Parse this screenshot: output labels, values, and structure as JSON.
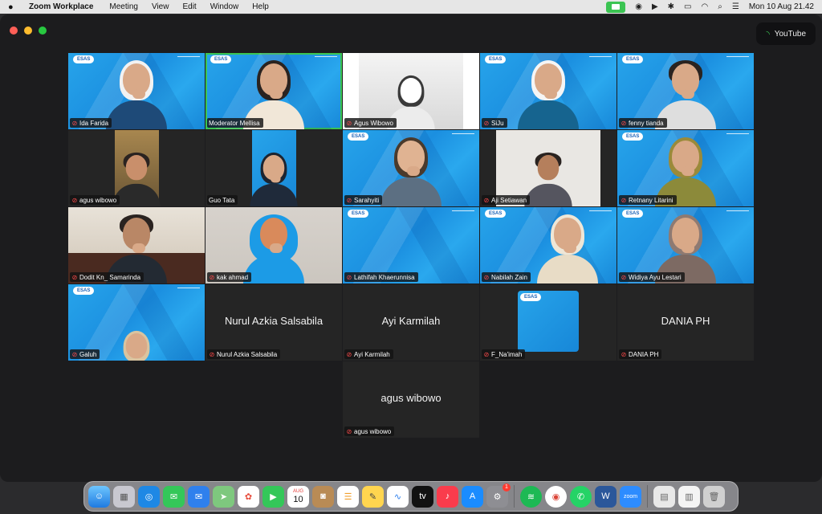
{
  "menubar": {
    "app_name": "Zoom Workplace",
    "menus": [
      "Meeting",
      "View",
      "Edit",
      "Window",
      "Help"
    ],
    "datetime": "Mon 10 Aug  21.42"
  },
  "window": {
    "livestream_label": "YouTube"
  },
  "logo_text": "ESAS",
  "participants": [
    {
      "name": "Ida Farida"
    },
    {
      "name": "Moderator Mellisa"
    },
    {
      "name": "Agus Wibowo"
    },
    {
      "name": "SiJu"
    },
    {
      "name": "fenny tianda"
    },
    {
      "name": "agus wibowo"
    },
    {
      "name": "Guo Tata"
    },
    {
      "name": "Sarahyiti"
    },
    {
      "name": "Aji Setiawan"
    },
    {
      "name": "Retnany Litarini"
    },
    {
      "name": "Dodit Kn_ Samarinda"
    },
    {
      "name": "kak ahmad"
    },
    {
      "name": "Lathifah Khaerunnisa"
    },
    {
      "name": "Nabilah Zain"
    },
    {
      "name": "Widiya Ayu Lestari"
    },
    {
      "name": "Galuh"
    },
    {
      "name": "Nurul Azkia Salsabila"
    },
    {
      "name": "Ayi Karmilah"
    },
    {
      "name": "F_Na'imah"
    },
    {
      "name": "DANIA PH"
    },
    {
      "name": "agus wibowo"
    }
  ],
  "dock": {
    "calendar_month": "AUG",
    "calendar_day": "10",
    "zoom_label": "zoom",
    "settings_badge": "1"
  }
}
